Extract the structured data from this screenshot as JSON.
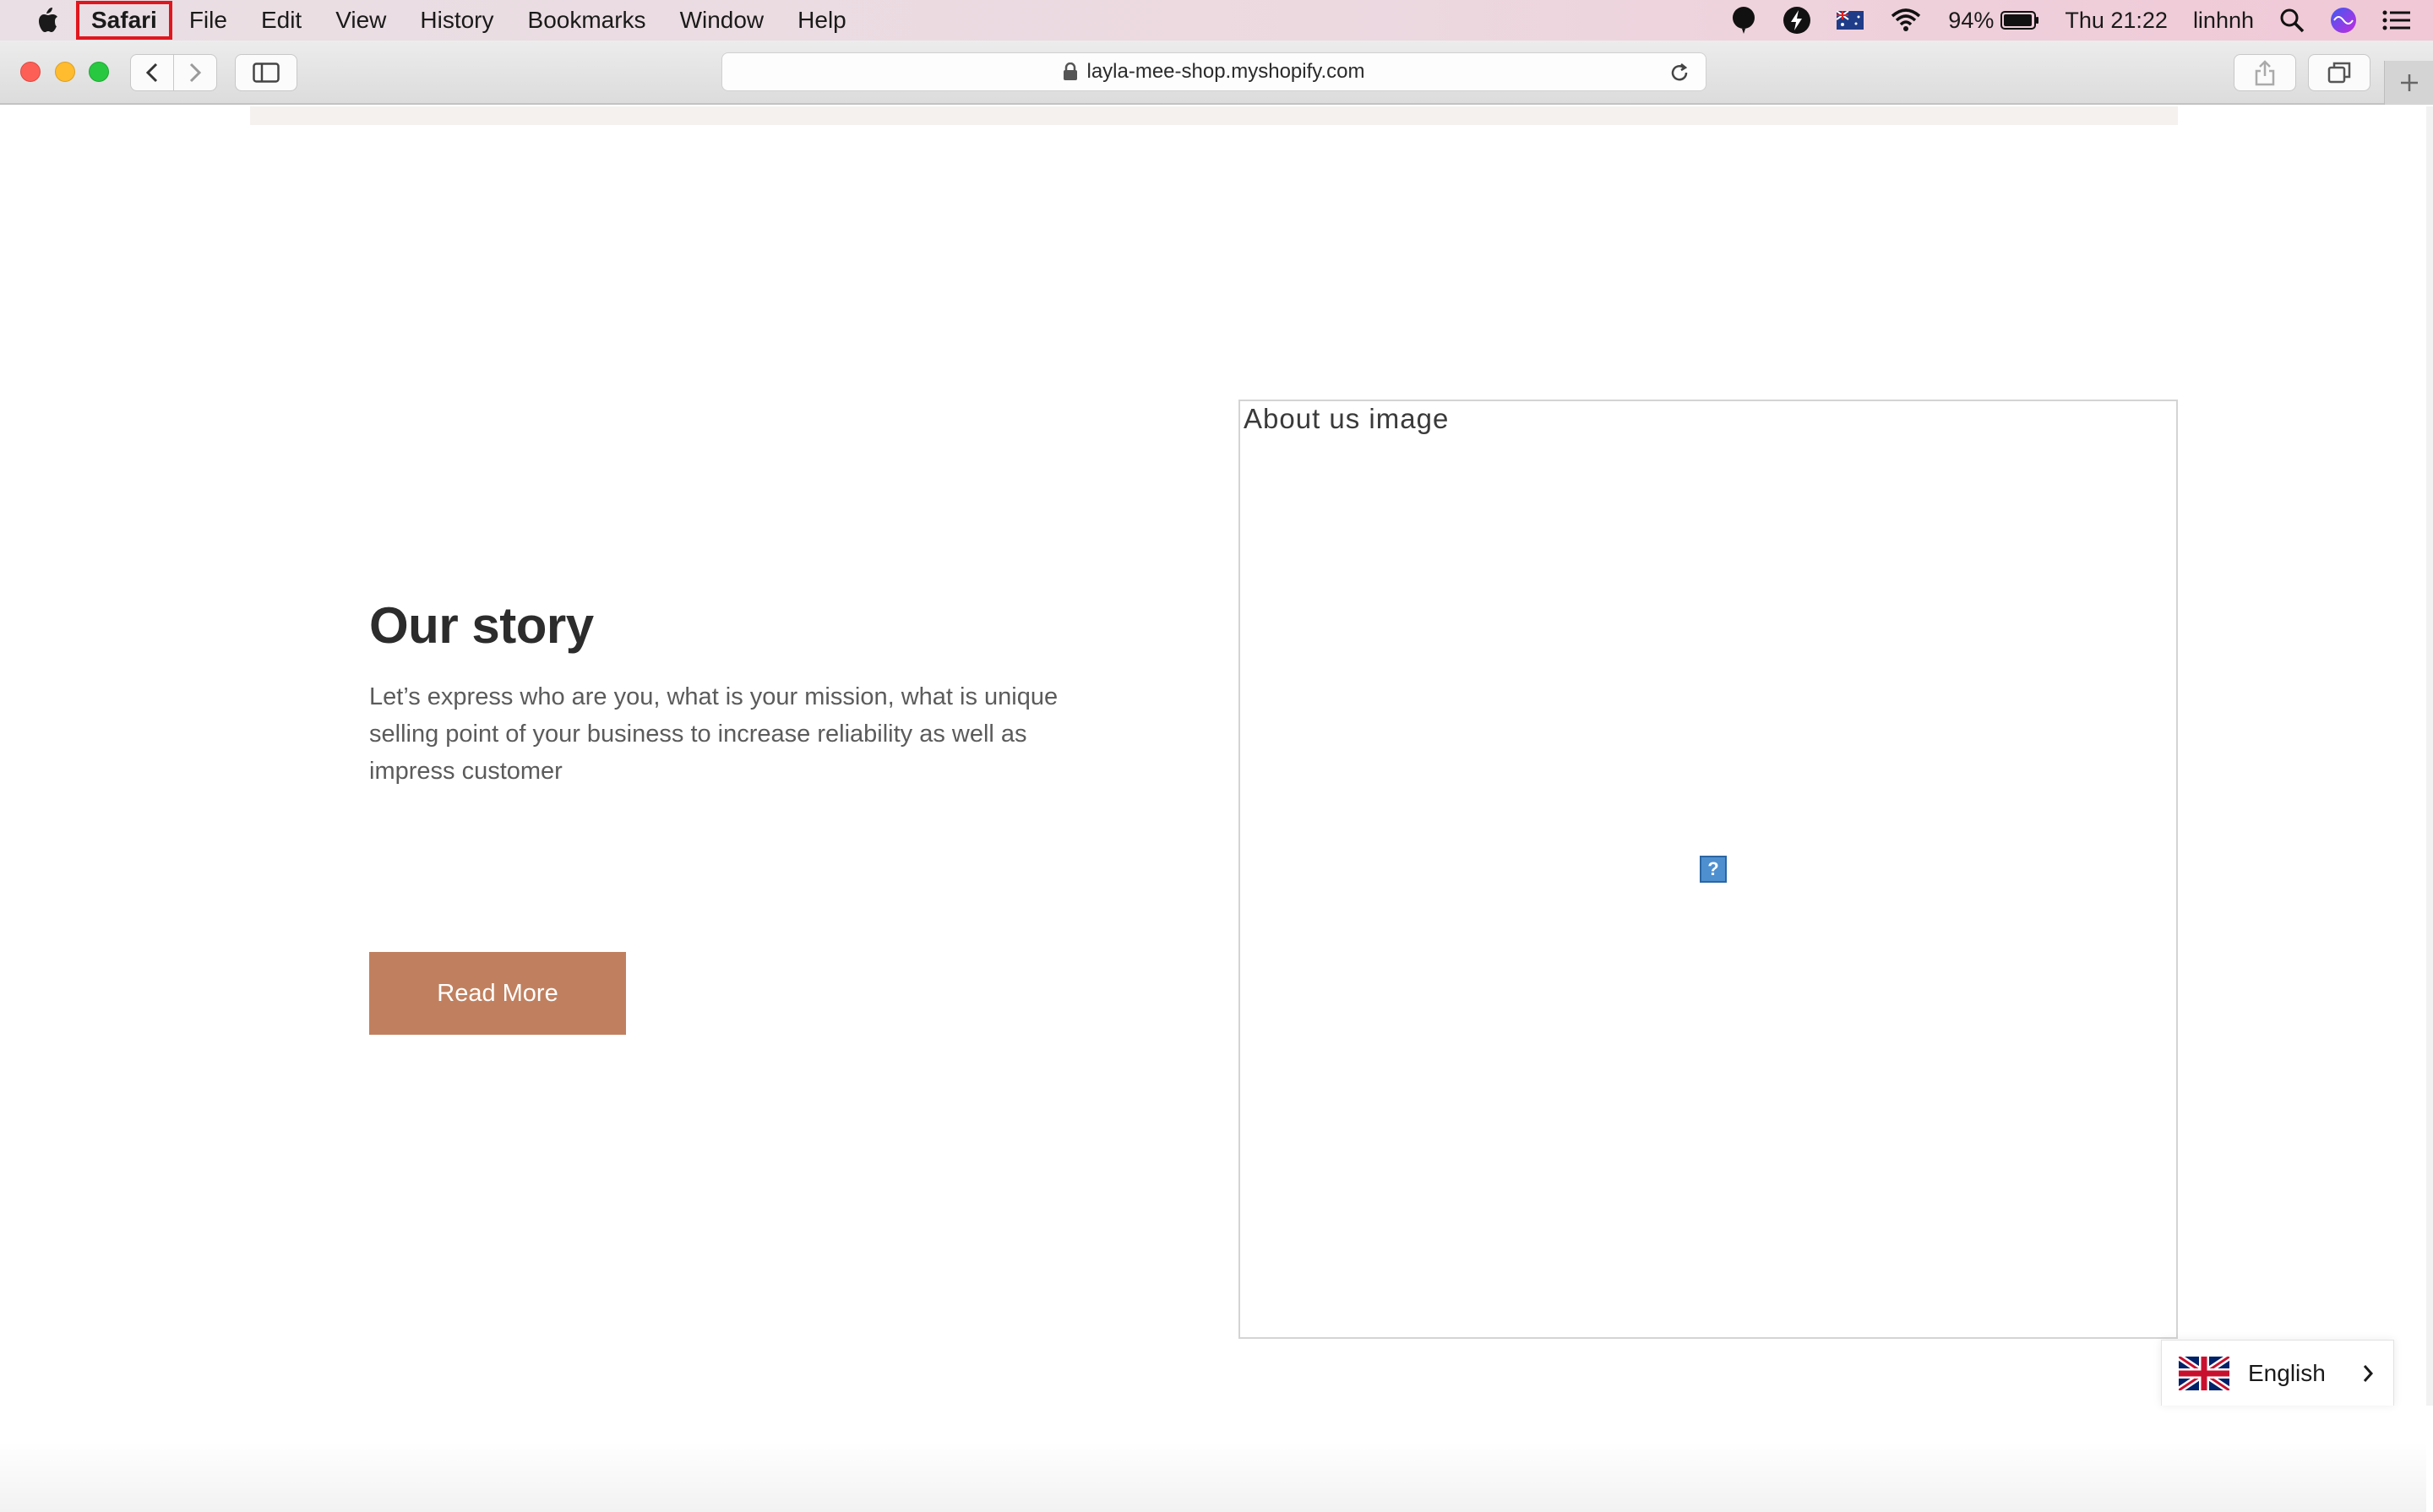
{
  "menubar": {
    "app_name": "Safari",
    "items": [
      "File",
      "Edit",
      "View",
      "History",
      "Bookmarks",
      "Window",
      "Help"
    ],
    "battery_percent": "94%",
    "clock": "Thu 21:22",
    "user": "linhnh"
  },
  "browser": {
    "url": "layla-mee-shop.myshopify.com"
  },
  "page": {
    "story_title": "Our story",
    "story_body": "Let’s express who are you, what is your mission, what is unique selling point of your business to increase reliability as well as impress customer",
    "cta_label": "Read More",
    "image_alt": "About us image",
    "missing_image_glyph": "?"
  },
  "language_switcher": {
    "label": "English"
  },
  "colors": {
    "cta_background": "#c0805f",
    "highlight_outline": "#e0161e"
  }
}
